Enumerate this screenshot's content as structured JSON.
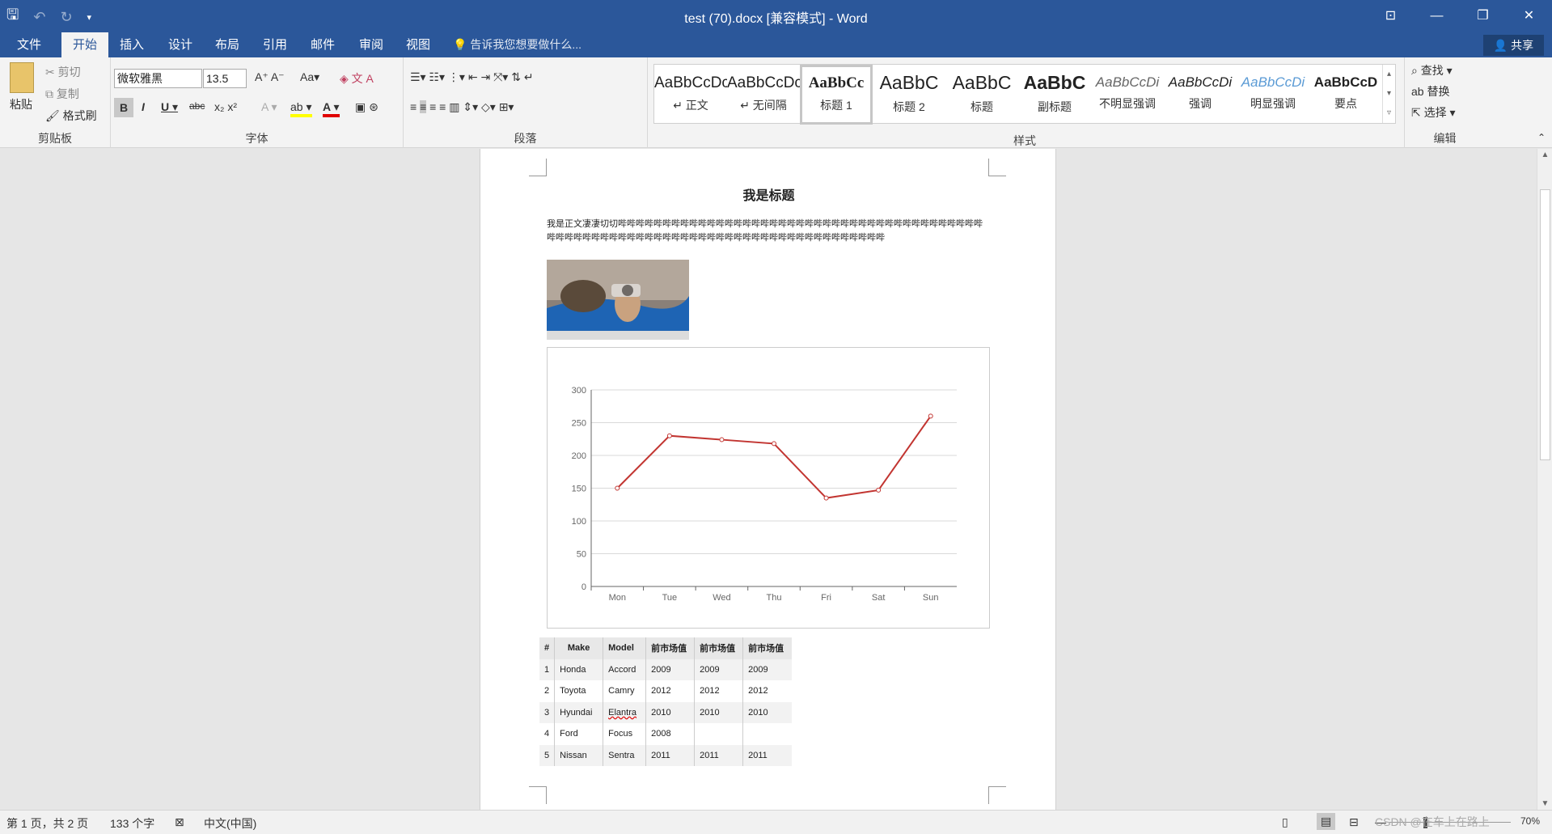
{
  "window": {
    "title": "test (70).docx [兼容模式] - Word"
  },
  "tabs": [
    "文件",
    "开始",
    "插入",
    "设计",
    "布局",
    "引用",
    "邮件",
    "审阅",
    "视图"
  ],
  "tell_me": "告诉我您想要做什么...",
  "share": "共享",
  "clipboard": {
    "paste": "粘贴",
    "cut": "剪切",
    "copy": "复制",
    "format_painter": "格式刷",
    "label": "剪贴板"
  },
  "font": {
    "name": "微软雅黑",
    "size": "13.5",
    "label": "字体"
  },
  "paragraph": {
    "label": "段落"
  },
  "styles": {
    "label": "样式",
    "items": [
      {
        "preview": "AaBbCcDc",
        "name": "↵ 正文"
      },
      {
        "preview": "AaBbCcDc",
        "name": "↵ 无间隔"
      },
      {
        "preview": "AaBbCc",
        "name": "标题 1"
      },
      {
        "preview": "AaBbC",
        "name": "标题 2"
      },
      {
        "preview": "AaBbC",
        "name": "标题"
      },
      {
        "preview": "AaBbC",
        "name": "副标题"
      },
      {
        "preview": "AaBbCcDi",
        "name": "不明显强调"
      },
      {
        "preview": "AaBbCcDi",
        "name": "强调"
      },
      {
        "preview": "AaBbCcDi",
        "name": "明显强调"
      },
      {
        "preview": "AaBbCcD",
        "name": "要点"
      }
    ]
  },
  "editing": {
    "find": "查找",
    "replace": "替换",
    "select": "选择",
    "label": "编辑"
  },
  "doc": {
    "title": "我是标题",
    "body": "我是正文凄凄切切哔哔哔哔哔哔哔哔哔哔哔哔哔哔哔哔哔哔哔哔哔哔哔哔哔哔哔哔哔哔哔哔哔哔哔哔哔哔哔哔哔哔哔哔哔哔哔哔哔哔哔哔哔哔哔哔哔哔哔哔哔哔哔哔哔哔哔哔哔哔哔哔哔哔哔哔哔哔哔",
    "table": {
      "headers": [
        "#",
        "Make",
        "Model",
        "前市场值",
        "前市场值",
        "前市场值"
      ],
      "rows": [
        [
          "1",
          "Honda",
          "Accord",
          "2009",
          "2009",
          "2009"
        ],
        [
          "2",
          "Toyota",
          "Camry",
          "2012",
          "2012",
          "2012"
        ],
        [
          "3",
          "Hyundai",
          "Elantra",
          "2010",
          "2010",
          "2010"
        ],
        [
          "4",
          "Ford",
          "Focus",
          "2008",
          "",
          ""
        ],
        [
          "5",
          "Nissan",
          "Sentra",
          "2011",
          "2011",
          "2011"
        ]
      ]
    }
  },
  "chart_data": {
    "type": "line",
    "categories": [
      "Mon",
      "Tue",
      "Wed",
      "Thu",
      "Fri",
      "Sat",
      "Sun"
    ],
    "series": [
      {
        "values": [
          150,
          230,
          224,
          218,
          135,
          147,
          260
        ],
        "color": "#c23531"
      }
    ],
    "ylim": [
      0,
      300
    ],
    "yticks": [
      0,
      50,
      100,
      150,
      200,
      250,
      300
    ],
    "grid": true
  },
  "status": {
    "page": "第 1 页，共 2 页",
    "words": "133 个字",
    "lang": "中文(中国)",
    "zoom": "70%",
    "watermark": "CSDN @在车上在路上"
  }
}
